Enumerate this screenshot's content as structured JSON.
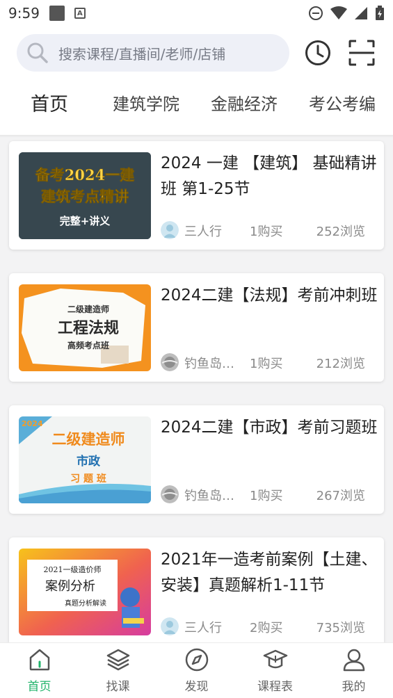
{
  "status_bar": {
    "time": "9:59"
  },
  "search": {
    "placeholder": "搜索课程/直播间/老师/店铺"
  },
  "tabs": [
    {
      "label": "首页",
      "active": true
    },
    {
      "label": "建筑学院",
      "active": false
    },
    {
      "label": "金融经济",
      "active": false
    },
    {
      "label": "考公考编",
      "active": false
    }
  ],
  "courses": [
    {
      "title": "2024 一建 【建筑】 基础精讲班 第1-25节",
      "author": "三人行",
      "buys": "1购买",
      "views": "252浏览",
      "thumb_lines": [
        "备考2024一建",
        "建筑考点精讲",
        "完整+讲义"
      ]
    },
    {
      "title": "2024二建【法规】考前冲刺班",
      "author": "钓鱼岛上...",
      "buys": "1购买",
      "views": "212浏览",
      "thumb_lines": [
        "二级建造师",
        "工程法规",
        "高频考点班"
      ]
    },
    {
      "title": "2024二建【市政】考前习题班",
      "author": "钓鱼岛上...",
      "buys": "1购买",
      "views": "267浏览",
      "thumb_lines": [
        "2024",
        "二级建造师",
        "市政",
        "习 题 班"
      ]
    },
    {
      "title": "2021年一造考前案例【土建、安装】真题解析1-11节",
      "author": "三人行",
      "buys": "2购买",
      "views": "735浏览",
      "thumb_lines": [
        "2021一级造价师",
        "案例分析",
        "真题分析解读"
      ]
    }
  ],
  "bottom_nav": [
    {
      "label": "首页",
      "icon": "home-icon",
      "active": true
    },
    {
      "label": "找课",
      "icon": "layers-icon",
      "active": false
    },
    {
      "label": "发现",
      "icon": "compass-icon",
      "active": false
    },
    {
      "label": "课程表",
      "icon": "graduation-cap-icon",
      "active": false
    },
    {
      "label": "我的",
      "icon": "user-icon",
      "active": false
    }
  ],
  "colors": {
    "accent": "#1fb36a",
    "search_bg": "#eef0f7"
  }
}
